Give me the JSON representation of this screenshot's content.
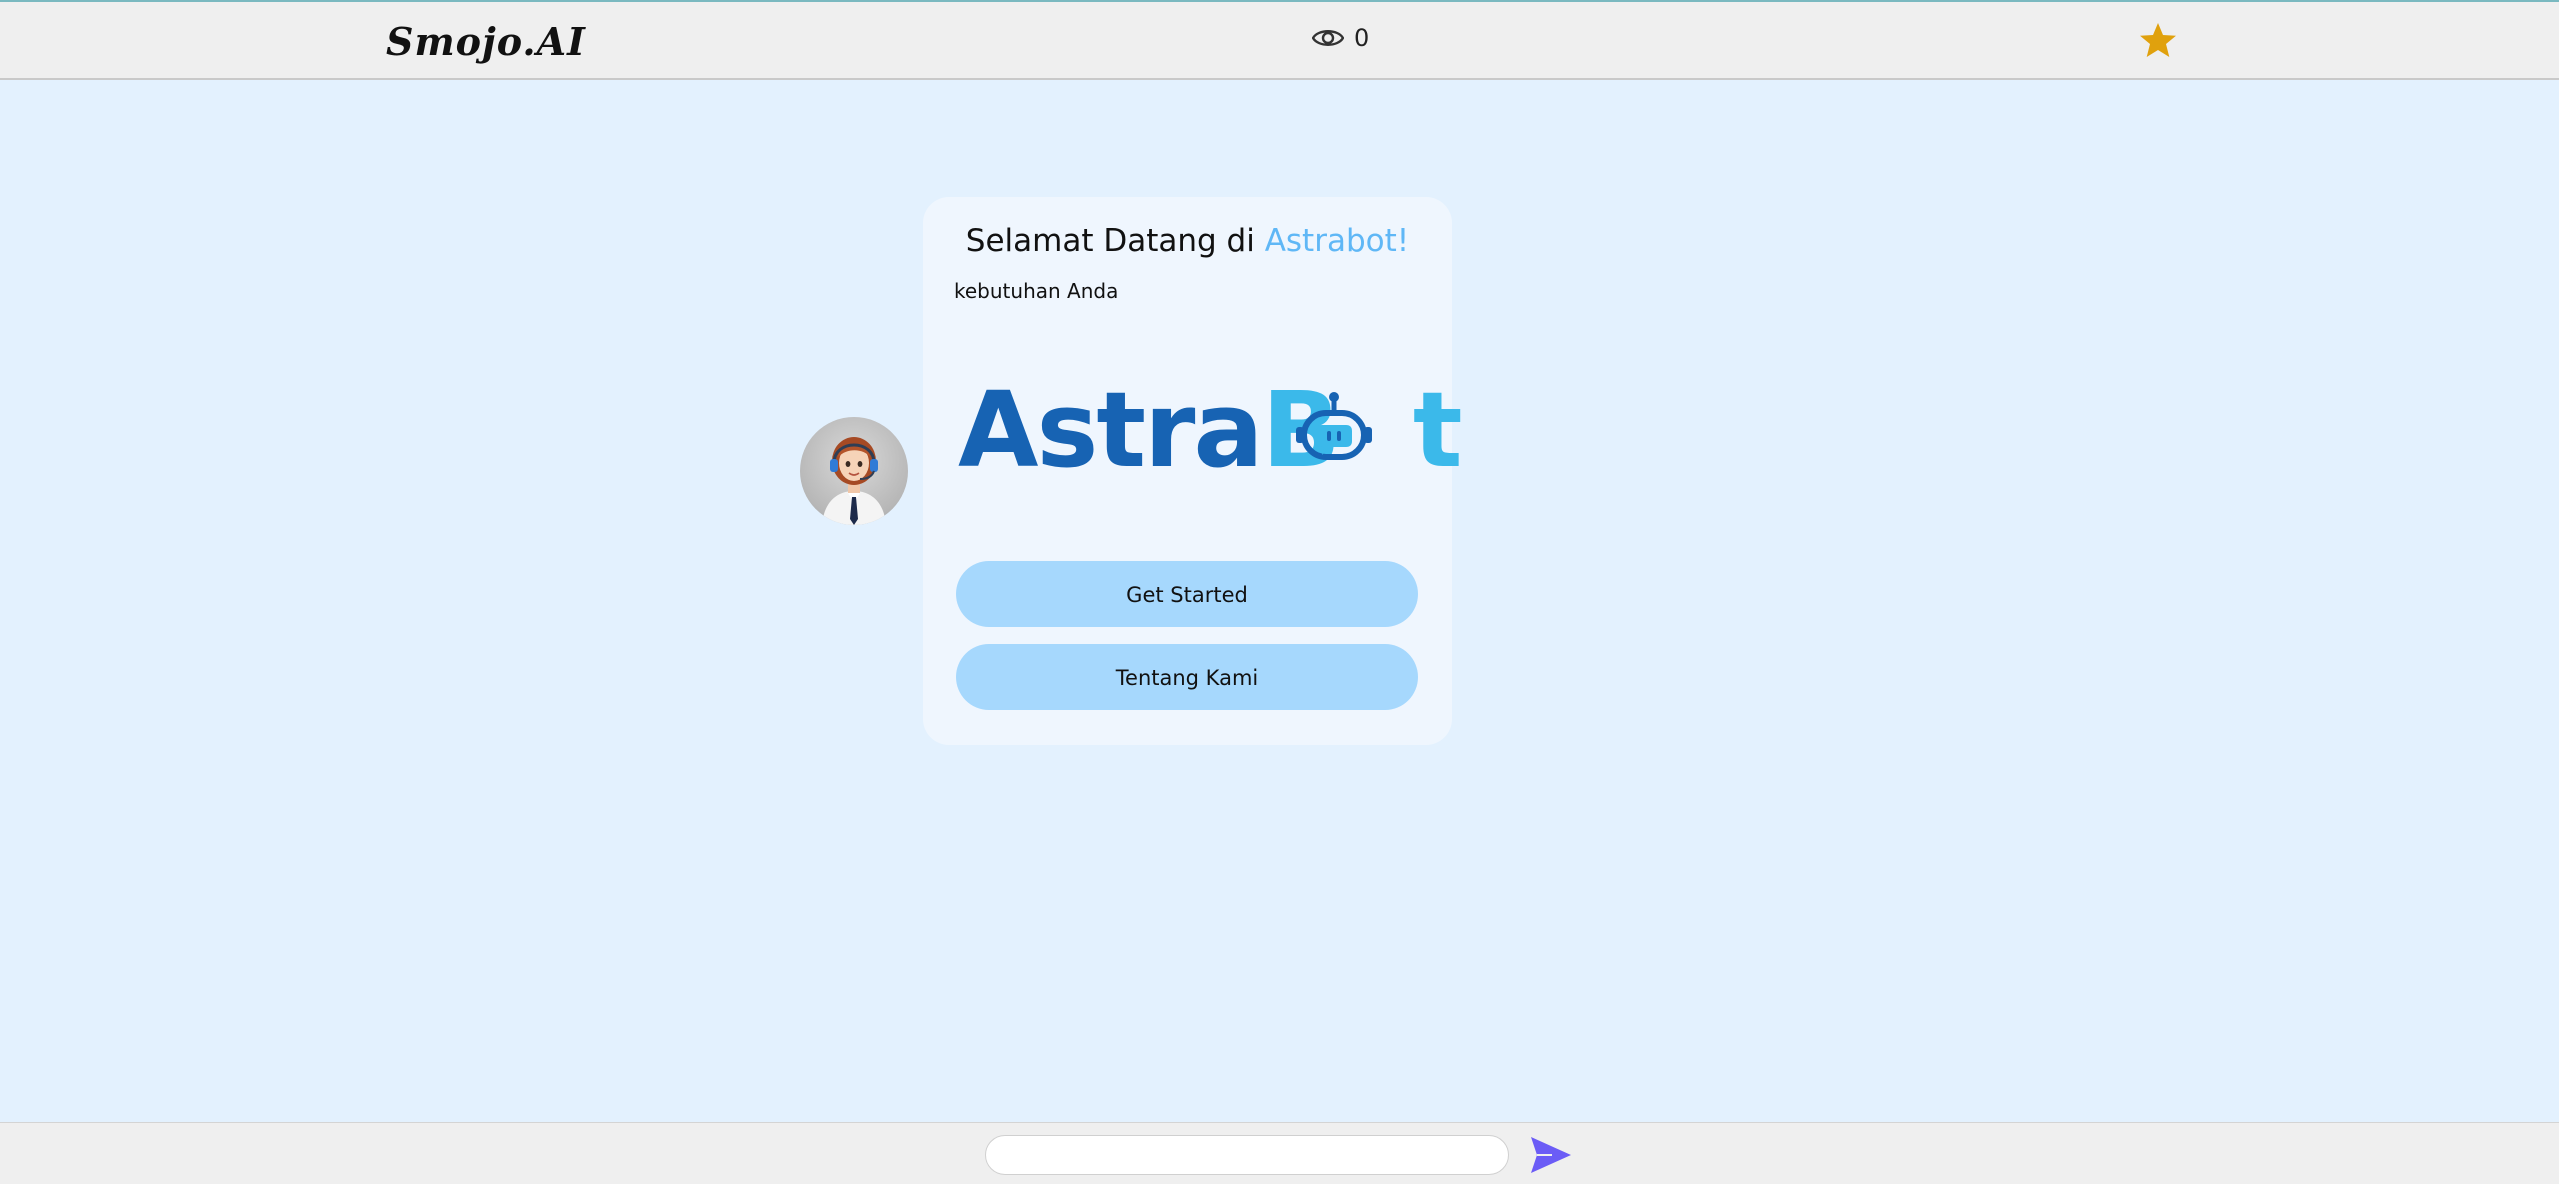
{
  "header": {
    "brand": "Smojo.AI",
    "view_count": "0",
    "icons": {
      "views": "eye-icon",
      "favorite": "star-icon"
    },
    "star_color": "#e0a10d"
  },
  "card": {
    "title_prefix": "Selamat Datang di ",
    "title_highlight": "Astrabot!",
    "subtitle": "kebutuhan Anda",
    "logo": {
      "dark_part": "Astra",
      "light_part": "B",
      "light_tail": "t"
    },
    "buttons": {
      "get_started": "Get Started",
      "about": "Tentang Kami"
    },
    "colors": {
      "highlight": "#5fb7f6",
      "button_bg": "#a6d8fd",
      "logo_dark": "#1763b3",
      "logo_light": "#3bb9ea"
    }
  },
  "chat": {
    "input_value": "",
    "send_icon": "send-icon",
    "send_color": "#6b5cf6"
  },
  "avatar": {
    "icon": "agent-avatar"
  }
}
